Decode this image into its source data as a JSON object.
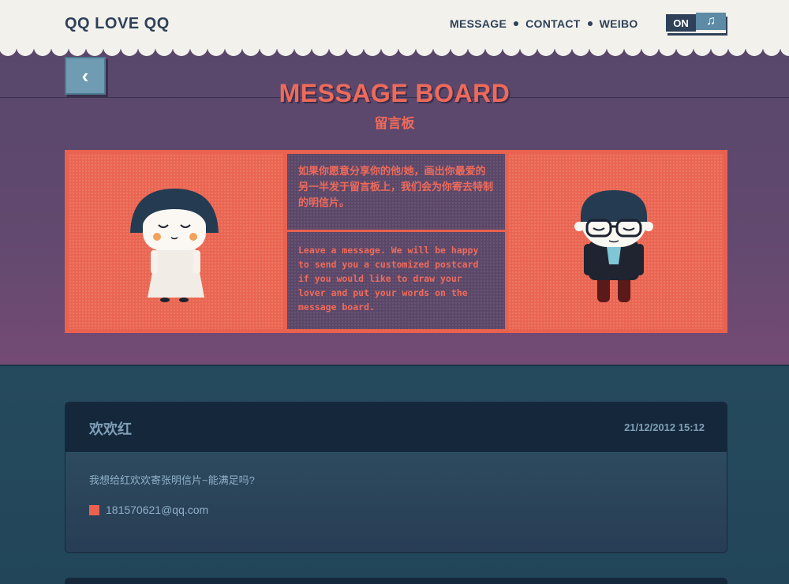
{
  "header": {
    "brand": "QQ LOVE QQ",
    "nav": [
      "MESSAGE",
      "CONTACT",
      "WEIBO"
    ],
    "toggle_label": "ON",
    "music_icon": "♫"
  },
  "hero": {
    "back_icon": "‹",
    "title": "MESSAGE BOARD",
    "subtitle": "留言板",
    "text_cn": "如果你愿意分享你的他/她，画出你最爱的另一半发于留言板上，我们会为你寄去特制的明信片。",
    "text_en": "Leave a message. We will be happy to send you a customized postcard if you would like to draw your lover and put your words on the message board."
  },
  "messages": [
    {
      "name": "欢欢红",
      "date": "21/12/2012 15:12",
      "text": "我想给红欢欢寄张明信片~能满足吗?",
      "email": "181570621@qq.com"
    }
  ],
  "colors": {
    "coral": "#e9614f",
    "purple": "#5b4768",
    "navy": "#2e4159",
    "teal": "#23445a"
  }
}
